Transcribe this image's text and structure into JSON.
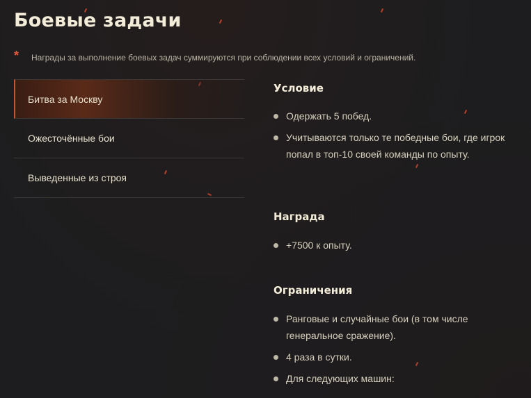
{
  "page": {
    "title": "Боевые задачи",
    "note": "Награды за выполнение боевых задач суммируются при соблюдении всех условий и ограничений.",
    "note_marker": "*"
  },
  "tabs": [
    {
      "label": "Битва за Москву",
      "active": true
    },
    {
      "label": "Ожесточённые бои",
      "active": false
    },
    {
      "label": "Выведенные из строя",
      "active": false
    }
  ],
  "sections": {
    "condition": {
      "title": "Условие",
      "items": [
        "Одержать 5 побед.",
        "Учитываются только те победные бои, где игрок попал в топ-10 своей команды по опыту."
      ]
    },
    "reward": {
      "title": "Награда",
      "items": [
        "+7500 к опыту."
      ]
    },
    "restrictions": {
      "title": "Ограничения",
      "items": [
        "Ранговые и случайные бои (в том числе генеральное сражение).",
        "4 раза в сутки.",
        "Для следующих машин:"
      ]
    }
  },
  "colors": {
    "background": "#1d1d1f",
    "accent": "#c9552f",
    "text": "#d6d0bd",
    "heading": "#f3ecd8"
  }
}
